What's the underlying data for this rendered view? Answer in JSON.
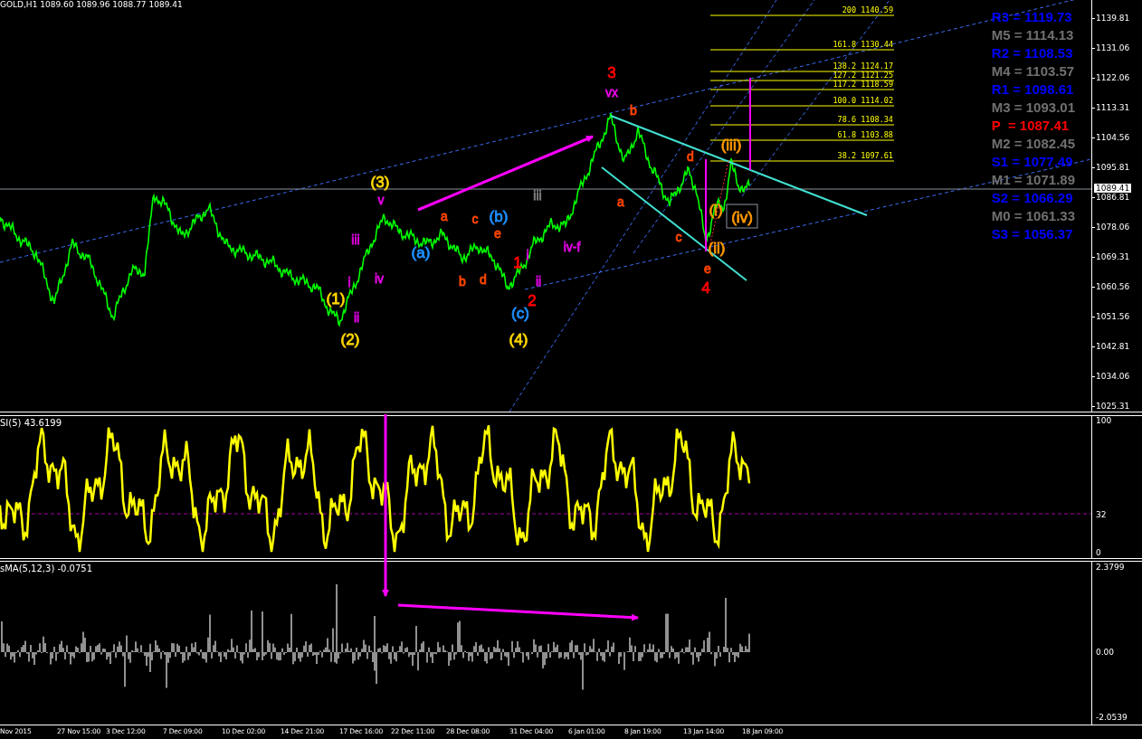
{
  "chart_title": "GOLD,H1 1089.60 1089.96 1088.77 1089.41",
  "price_axis": [
    "1139.81",
    "1131.06",
    "1122.06",
    "1113.31",
    "1104.56",
    "1095.81",
    "1086.81",
    "1078.06",
    "1069.31",
    "1060.56",
    "1051.56",
    "1042.81",
    "1034.06",
    "1025.31"
  ],
  "current_price": "1089.41",
  "fib_levels": [
    "200 1140.59",
    "161.8 1130.44",
    "138.2 1124.17",
    "127.2 1121.25",
    "117.2 1118.59",
    "100.0  1114.02",
    "78.6 1108.34",
    "61.8 1103.88",
    "38.2 1097.61"
  ],
  "pivot_levels": [
    {
      "label": "R3 = 1119.73",
      "color": "#0000ff"
    },
    {
      "label": "M5 = 1114.13",
      "color": "#707070"
    },
    {
      "label": "R2 = 1108.53",
      "color": "#0000ff"
    },
    {
      "label": "M4 = 1103.57",
      "color": "#707070"
    },
    {
      "label": "R1 = 1098.61",
      "color": "#0000ff"
    },
    {
      "label": "M3 = 1093.01",
      "color": "#707070"
    },
    {
      "label": "P  = 1087.41",
      "color": "#ff0000"
    },
    {
      "label": "M2 = 1082.45",
      "color": "#707070"
    },
    {
      "label": "S1 = 1077.49",
      "color": "#0000ff"
    },
    {
      "label": "M1 = 1071.89",
      "color": "#707070"
    },
    {
      "label": "S2 = 1066.29",
      "color": "#0000ff"
    },
    {
      "label": "M0 = 1061.33",
      "color": "#707070"
    },
    {
      "label": "S3 = 1056.37",
      "color": "#0000ff"
    }
  ],
  "wave_labels": [
    {
      "text": "3",
      "color": "#ff0000"
    },
    {
      "text": "vx",
      "color": "#e000e0"
    },
    {
      "text": "b",
      "color": "#ff4500"
    },
    {
      "text": "a",
      "color": "#ff4500"
    },
    {
      "text": "d",
      "color": "#ff4500"
    },
    {
      "text": "(iii)",
      "color": "#ff9900"
    },
    {
      "text": "(i)",
      "color": "#ff9900"
    },
    {
      "text": "(iv)",
      "color": "#ff9900"
    },
    {
      "text": "(ii)",
      "color": "#ff9900"
    },
    {
      "text": "c",
      "color": "#ff4500"
    },
    {
      "text": "e",
      "color": "#ff4500"
    },
    {
      "text": "4",
      "color": "#ff0000"
    },
    {
      "text": "(3)",
      "color": "#ffd700"
    },
    {
      "text": "v",
      "color": "#e000e0"
    },
    {
      "text": "a",
      "color": "#ff4500"
    },
    {
      "text": "c",
      "color": "#ff4500"
    },
    {
      "text": "(b)",
      "color": "#1e90ff"
    },
    {
      "text": "e",
      "color": "#ff4500"
    },
    {
      "text": "iii",
      "color": "#808080"
    },
    {
      "text": "iv-f",
      "color": "#e000e0"
    },
    {
      "text": "(a)",
      "color": "#1e90ff"
    },
    {
      "text": "b",
      "color": "#ff4500"
    },
    {
      "text": "d",
      "color": "#ff4500"
    },
    {
      "text": "1",
      "color": "#ff0000"
    },
    {
      "text": "i",
      "color": "#e000e0"
    },
    {
      "text": "ii",
      "color": "#e000e0"
    },
    {
      "text": "2",
      "color": "#ff0000"
    },
    {
      "text": "(c)",
      "color": "#1e90ff"
    },
    {
      "text": "(4)",
      "color": "#ffd700"
    },
    {
      "text": "iii",
      "color": "#e000e0"
    },
    {
      "text": "i",
      "color": "#e000e0"
    },
    {
      "text": "iv",
      "color": "#e000e0"
    },
    {
      "text": "(1)",
      "color": "#ffd700"
    },
    {
      "text": "ii",
      "color": "#e000e0"
    },
    {
      "text": "(2)",
      "color": "#ffd700"
    }
  ],
  "rsi": {
    "title": "SI(5) 43.6199",
    "axis": [
      "100",
      "32",
      "0"
    ]
  },
  "osma": {
    "title": "sMA(5,12,3) -0.0751",
    "axis": [
      "2.3799",
      "0.00",
      "-2.0539"
    ]
  },
  "time_axis": [
    "Nov 2015",
    "27 Nov 15:00",
    "3 Dec 12:00",
    "7 Dec 09:00",
    "10 Dec 02:00",
    "14 Dec 21:00",
    "17 Dec 16:00",
    "22 Dec 11:00",
    "28 Dec 08:00",
    "31 Dec 04:00",
    "6 Jan 01:00",
    "8 Jan 19:00",
    "13 Jan 14:00",
    "18 Jan 09:00"
  ]
}
